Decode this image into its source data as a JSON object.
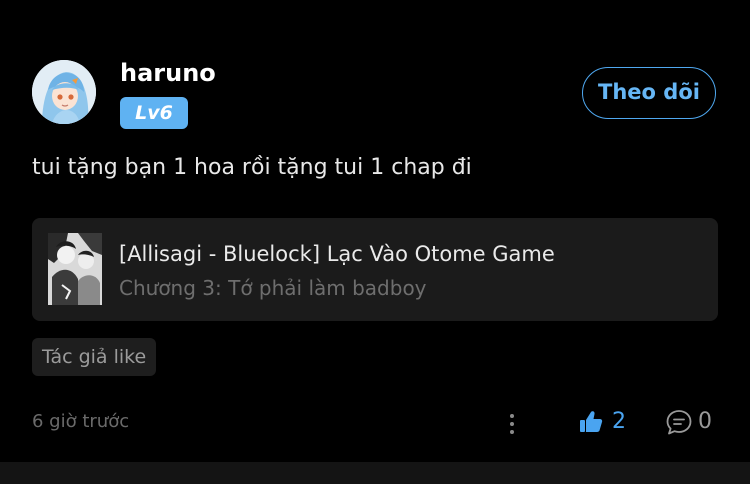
{
  "post": {
    "author": {
      "name": "haruno",
      "level": "Lv6",
      "avatar_icon": "anime-avatar"
    },
    "follow_label": "Theo dõi",
    "content": "tui tặng bạn 1 hoa rồi tặng tui 1 chap đi",
    "story": {
      "title": "[Allisagi - Bluelock] Lạc Vào Otome Game",
      "chapter": "Chương 3: Tớ phải làm badboy",
      "cover_icon": "story-cover-image"
    },
    "tag": "Tác giả like",
    "timestamp": "6 giờ trước",
    "likes": "2",
    "comments": "0"
  },
  "colors": {
    "background": "#000000",
    "accent_blue": "#4fa8f0",
    "card_background": "#1b1b1b",
    "muted_text": "#6a6a6a"
  }
}
